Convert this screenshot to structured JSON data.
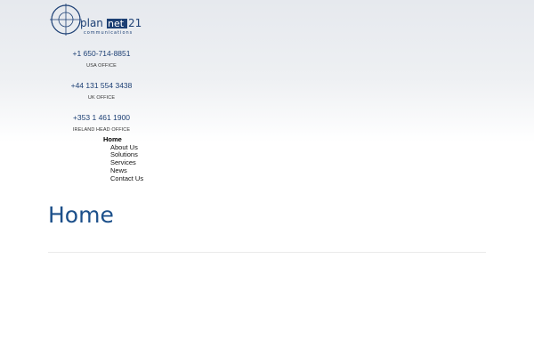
{
  "logo": {
    "text_main_a": "plan",
    "text_main_b": "net",
    "text_main_c": "21",
    "text_sub": "communications"
  },
  "offices": [
    {
      "phone": "+1 650-714-8851",
      "label": "USA OFFICE"
    },
    {
      "phone": "+44 131 554 3438",
      "label": "UK OFFICE"
    },
    {
      "phone": "+353 1 461 1900",
      "label": "IRELAND HEAD OFFICE"
    }
  ],
  "nav": {
    "items": [
      {
        "label": "Home"
      },
      {
        "label": "About Us"
      },
      {
        "label": "Solutions"
      },
      {
        "label": "Services"
      },
      {
        "label": "News"
      },
      {
        "label": "Contact Us"
      }
    ]
  },
  "page": {
    "title": "Home"
  },
  "colors": {
    "brand": "#1b4f8a",
    "phone_text": "#1c3f74"
  }
}
